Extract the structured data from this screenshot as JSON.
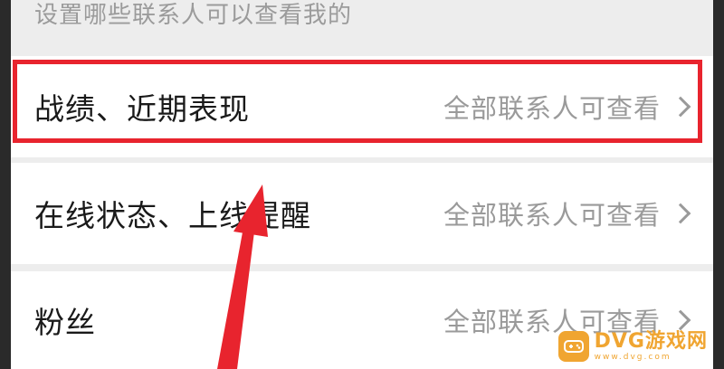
{
  "section": {
    "caption": "设置哪些联系人可以查看我的"
  },
  "settings": [
    {
      "label": "战绩、近期表现",
      "value": "全部联系人可查看"
    },
    {
      "label": "在线状态、上线提醒",
      "value": "全部联系人可查看"
    },
    {
      "label": "粉丝",
      "value": "全部联系人可查看"
    }
  ],
  "annotation": {
    "highlight_color": "#e8242e",
    "arrow_color": "#e8242e"
  },
  "watermark": {
    "brand": "DVG游戏网",
    "url": "www.dvg.com"
  },
  "colors": {
    "panel_bg": "#ededed",
    "row_bg": "#ffffff",
    "label_text": "#1a1a1a",
    "value_text": "#9a9a9a",
    "watermark_accent": "#f0a531"
  }
}
